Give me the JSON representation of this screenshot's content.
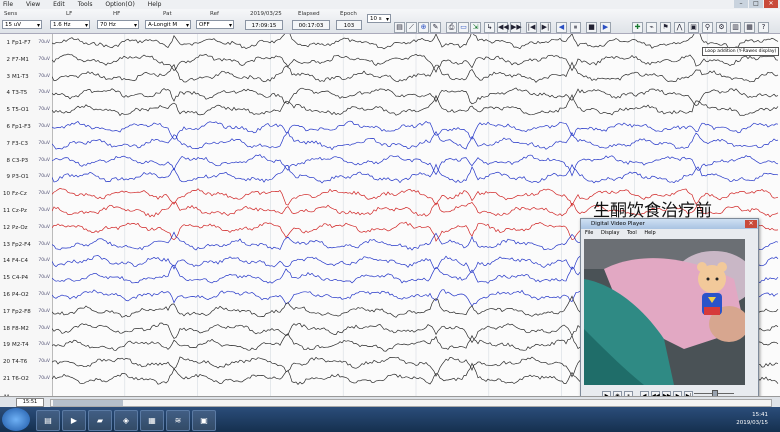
{
  "menu": [
    "File",
    "View",
    "Edit",
    "Tools",
    "Option(O)",
    "Help"
  ],
  "toolbar": {
    "sens_label": "Sens",
    "sens_value": "15 uV",
    "lf_label": "LF",
    "lf_value": "1.6 Hz",
    "hf_label": "HF",
    "hf_value": "70 Hz",
    "pat_label": "Pat",
    "pat_value": "A-Longit M",
    "ref_label": "Ref",
    "ref_value": "OFF",
    "date": "2019/03/25",
    "time": "17:09:15",
    "elapsed_label": "Elapsed",
    "elapsed_value": "00:17:03",
    "epoch_label": "Epoch",
    "epoch_value": "103",
    "span_value": "10 s"
  },
  "tooltip": "Loop addition (Y-Rawes display)",
  "channels": [
    {
      "n": "1",
      "name": "Fp1-F7",
      "color": "#2a2a2a"
    },
    {
      "n": "2",
      "name": "F7-M1",
      "color": "#2a2a2a"
    },
    {
      "n": "3",
      "name": "M1-T3",
      "color": "#2a2a2a"
    },
    {
      "n": "4",
      "name": "T3-T5",
      "color": "#2a2a2a"
    },
    {
      "n": "5",
      "name": "T5-O1",
      "color": "#2a2a2a"
    },
    {
      "n": "6",
      "name": "Fp1-F3",
      "color": "#2436c8"
    },
    {
      "n": "7",
      "name": "F3-C3",
      "color": "#2436c8"
    },
    {
      "n": "8",
      "name": "C3-P3",
      "color": "#2436c8"
    },
    {
      "n": "9",
      "name": "P3-O1",
      "color": "#2436c8"
    },
    {
      "n": "10",
      "name": "Fz-Cz",
      "color": "#d02424"
    },
    {
      "n": "11",
      "name": "Cz-Pz",
      "color": "#d02424"
    },
    {
      "n": "12",
      "name": "Pz-Oz",
      "color": "#d02424"
    },
    {
      "n": "13",
      "name": "Fp2-F4",
      "color": "#2436c8"
    },
    {
      "n": "14",
      "name": "F4-C4",
      "color": "#2436c8"
    },
    {
      "n": "15",
      "name": "C4-P4",
      "color": "#2436c8"
    },
    {
      "n": "16",
      "name": "P4-O2",
      "color": "#2436c8"
    },
    {
      "n": "17",
      "name": "Fp2-F8",
      "color": "#2a2a2a"
    },
    {
      "n": "18",
      "name": "F8-M2",
      "color": "#2a2a2a"
    },
    {
      "n": "19",
      "name": "M2-T4",
      "color": "#2a2a2a"
    },
    {
      "n": "20",
      "name": "T4-T6",
      "color": "#2a2a2a"
    },
    {
      "n": "21",
      "name": "T6-O2",
      "color": "#2a2a2a"
    }
  ],
  "channel_sens": "70uV",
  "marker_label": "M",
  "scroll_time": "15:51",
  "overlay_caption": "生酮饮食治疗前",
  "player": {
    "title": "Digital Video Player",
    "menu": [
      "File",
      "Display",
      "Tool",
      "Help"
    ],
    "slow_label": "Slow",
    "fast_label": "Fast"
  },
  "clock": {
    "time": "15:41",
    "date": "2019/03/15"
  }
}
